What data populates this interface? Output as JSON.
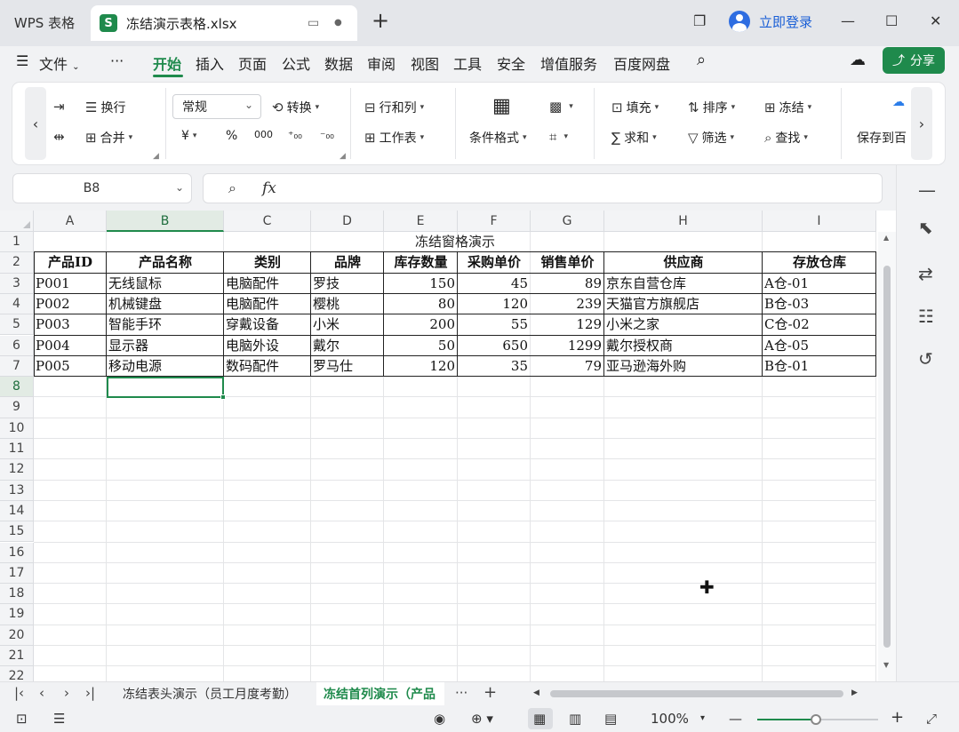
{
  "titlebar": {
    "app_tab": "WPS 表格",
    "doc_icon": "S",
    "doc_title": "冻结演示表格.xlsx",
    "login": "立即登录"
  },
  "menu": {
    "items": [
      "文件",
      "···",
      "开始",
      "插入",
      "页面",
      "公式",
      "数据",
      "审阅",
      "视图",
      "工具",
      "安全",
      "增值服务",
      "百度网盘"
    ],
    "active": "开始",
    "share": "分享"
  },
  "ribbon": {
    "wrap": "换行",
    "merge": "合并",
    "format": "常规",
    "convert": "转换",
    "currency": "¥",
    "percent": "%",
    "thousands": "000",
    "rows_cols": "行和列",
    "worksheet": "工作表",
    "cond_format": "条件格式",
    "fill": "填充",
    "sort": "排序",
    "freeze": "冻结",
    "sum": "求和",
    "filter": "筛选",
    "find": "查找",
    "save_to": "保存到百"
  },
  "formula_bar": {
    "cell_ref": "B8",
    "fx": "fx",
    "value": ""
  },
  "sheet": {
    "columns": [
      "A",
      "B",
      "C",
      "D",
      "E",
      "F",
      "G",
      "H",
      "I"
    ],
    "selected_column": "B",
    "rows": [
      "1",
      "2",
      "3",
      "4",
      "5",
      "6",
      "7",
      "8",
      "9",
      "10",
      "11",
      "12",
      "13",
      "14",
      "15",
      "16",
      "17",
      "18",
      "19",
      "20",
      "21",
      "22"
    ],
    "selected_row": "8",
    "title": "冻结窗格演示",
    "headers": [
      "产品ID",
      "产品名称",
      "类别",
      "品牌",
      "库存数量",
      "采购单价",
      "销售单价",
      "供应商",
      "存放仓库"
    ],
    "data": [
      [
        "P001",
        "无线鼠标",
        "电脑配件",
        "罗技",
        "150",
        "45",
        "89",
        "京东自营仓库",
        "A仓-01"
      ],
      [
        "P002",
        "机械键盘",
        "电脑配件",
        "樱桃",
        "80",
        "120",
        "239",
        "天猫官方旗舰店",
        "B仓-03"
      ],
      [
        "P003",
        "智能手环",
        "穿戴设备",
        "小米",
        "200",
        "55",
        "129",
        "小米之家",
        "C仓-02"
      ],
      [
        "P004",
        "显示器",
        "电脑外设",
        "戴尔",
        "50",
        "650",
        "1299",
        "戴尔授权商",
        "A仓-05"
      ],
      [
        "P005",
        "移动电源",
        "数码配件",
        "罗马仕",
        "120",
        "35",
        "79",
        "亚马逊海外购",
        "B仓-01"
      ]
    ]
  },
  "sheet_tabs": {
    "tabs": [
      "冻结表头演示（员工月度考勤）",
      "冻结首列演示（产品"
    ],
    "active_index": 1,
    "more": "···",
    "add": "+"
  },
  "status": {
    "zoom": "100%"
  }
}
